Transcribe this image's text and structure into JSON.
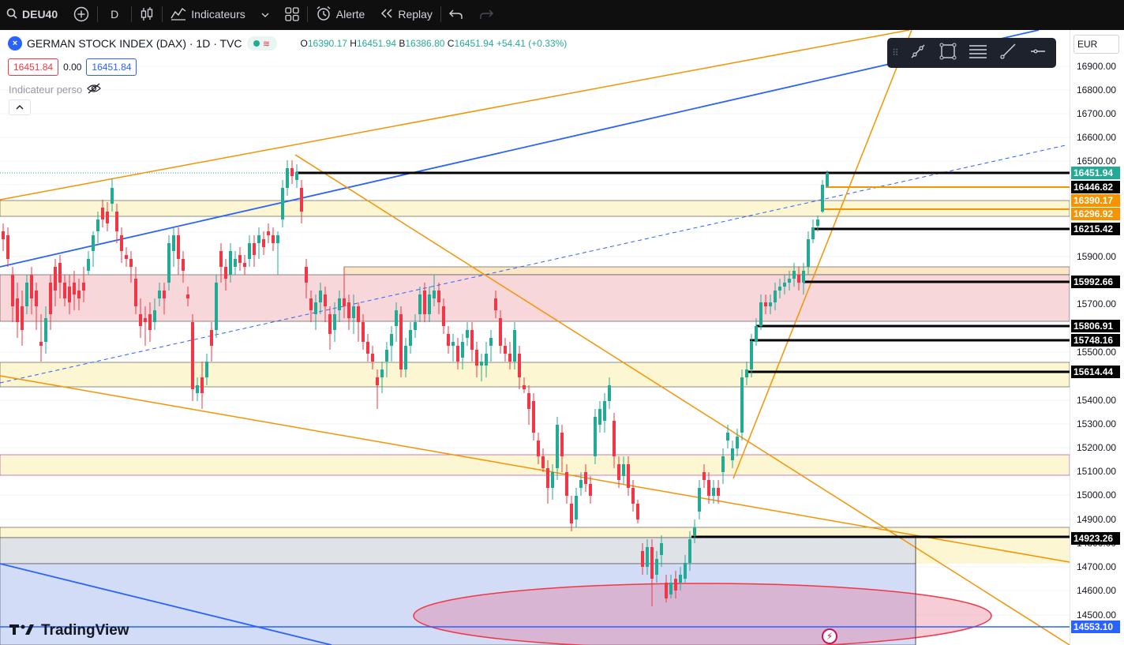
{
  "toolbar": {
    "symbol": "DEU40",
    "interval": "D",
    "indicators_label": "Indicateurs",
    "alert_label": "Alerte",
    "replay_label": "Replay"
  },
  "legend": {
    "title": "GERMAN STOCK INDEX (DAX) · 1D · TVC",
    "o_label": "O",
    "o_value": "16390.17",
    "h_label": "H",
    "h_value": "16451.94",
    "b_label": "B",
    "b_value": "16386.80",
    "c_label": "C",
    "c_value": "16451.94",
    "change": "+54.41 (+0.33%)"
  },
  "quotes": {
    "bid": "16451.84",
    "spread": "0.00",
    "ask": "16451.84"
  },
  "indicator_label": "Indicateur perso",
  "axis": {
    "currency": "EUR",
    "ticks": [
      "16900.00",
      "16800.00",
      "16700.00",
      "16600.00",
      "16500.00",
      "16100.00",
      "15900.00",
      "15700.00",
      "15500.00",
      "15400.00",
      "15300.00",
      "15200.00",
      "15100.00",
      "15000.00",
      "14900.00",
      "14800.00",
      "14700.00",
      "14600.00",
      "14500.00"
    ],
    "price_labels": [
      {
        "text": "16451.94",
        "bg": "#22ab94",
        "fg": "#ffffff"
      },
      {
        "text": "16446.82",
        "bg": "#000000",
        "fg": "#ffffff"
      },
      {
        "text": "16390.17",
        "bg": "#f59300",
        "fg": "#ffffff"
      },
      {
        "text": "16296.92",
        "bg": "#f59300",
        "fg": "#ffffff"
      },
      {
        "text": "16215.42",
        "bg": "#000000",
        "fg": "#ffffff"
      },
      {
        "text": "15992.66",
        "bg": "#000000",
        "fg": "#ffffff"
      },
      {
        "text": "15806.91",
        "bg": "#000000",
        "fg": "#ffffff"
      },
      {
        "text": "15748.16",
        "bg": "#000000",
        "fg": "#ffffff"
      },
      {
        "text": "15614.44",
        "bg": "#000000",
        "fg": "#ffffff"
      },
      {
        "text": "14923.26",
        "bg": "#000000",
        "fg": "#ffffff"
      },
      {
        "text": "14553.10",
        "bg": "#2962ff",
        "fg": "#ffffff"
      }
    ]
  },
  "watermark": "TradingView"
}
